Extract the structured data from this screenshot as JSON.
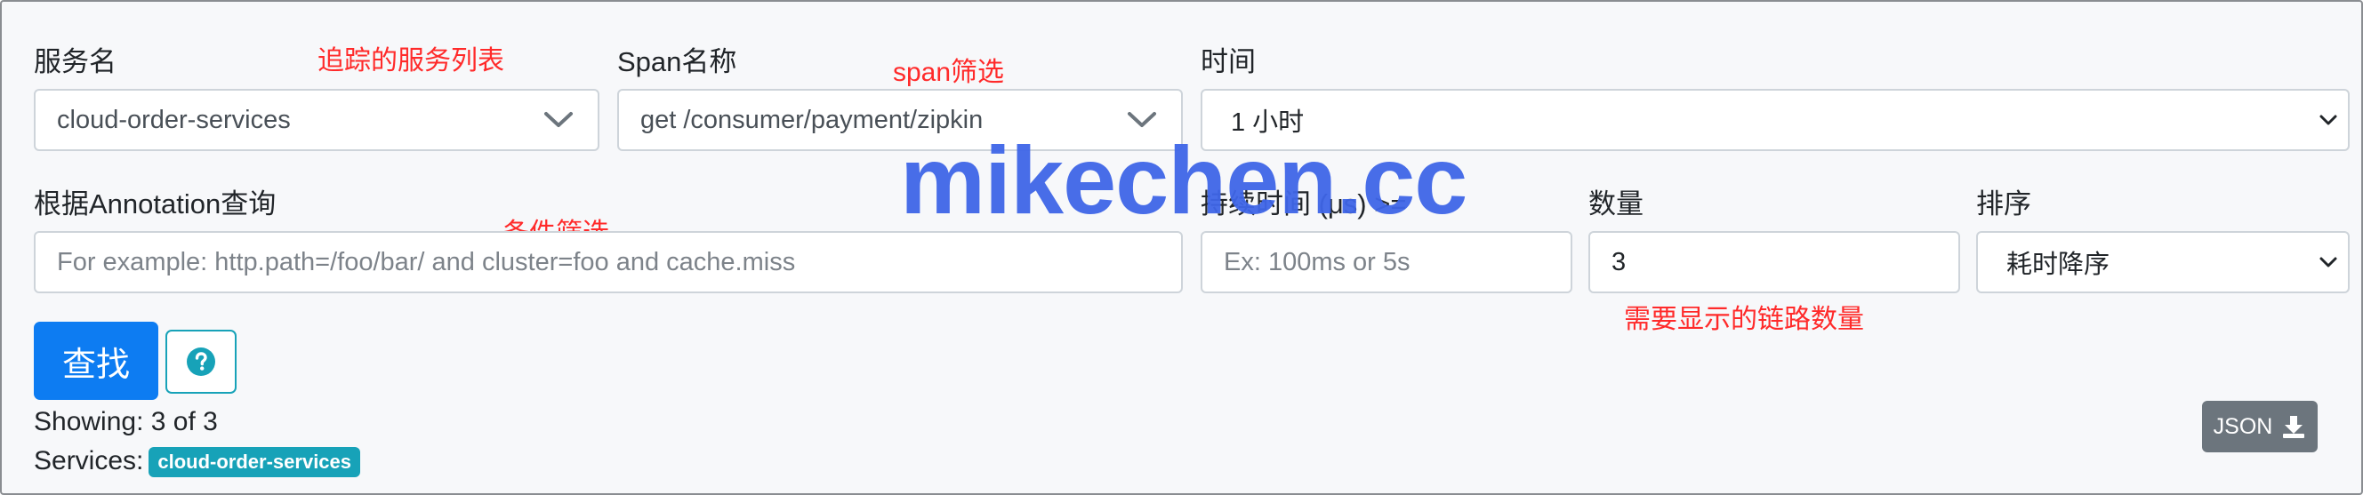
{
  "form": {
    "service_name": {
      "label": "服务名",
      "value": "cloud-order-services",
      "annotation": "追踪的服务列表"
    },
    "span_name": {
      "label": "Span名称",
      "value": "get /consumer/payment/zipkin",
      "annotation": "span筛选"
    },
    "time": {
      "label": "时间",
      "value": "1 小时"
    },
    "annotation_query": {
      "label": "根据Annotation查询",
      "placeholder": "For example: http.path=/foo/bar/ and cluster=foo and cache.miss",
      "annotation": "条件筛选"
    },
    "duration": {
      "label": "持续时间 (μs) >=",
      "placeholder": "Ex: 100ms or 5s"
    },
    "limit": {
      "label": "数量",
      "value": "3",
      "annotation": "需要显示的链路数量"
    },
    "sort": {
      "label": "排序",
      "value": "耗时降序"
    }
  },
  "actions": {
    "find_label": "查找",
    "help_icon": "question-circle-icon",
    "json_label": "JSON",
    "json_icon": "download-icon"
  },
  "results": {
    "showing": "Showing: 3 of 3",
    "services_label": "Services:",
    "services": [
      "cloud-order-services"
    ]
  },
  "watermark": "mikechen.cc",
  "colors": {
    "primary": "#0d7cf2",
    "info": "#17a2b8",
    "secondary": "#6c757d",
    "annotation": "#ff2a2a",
    "watermark": "#3f66e8"
  }
}
